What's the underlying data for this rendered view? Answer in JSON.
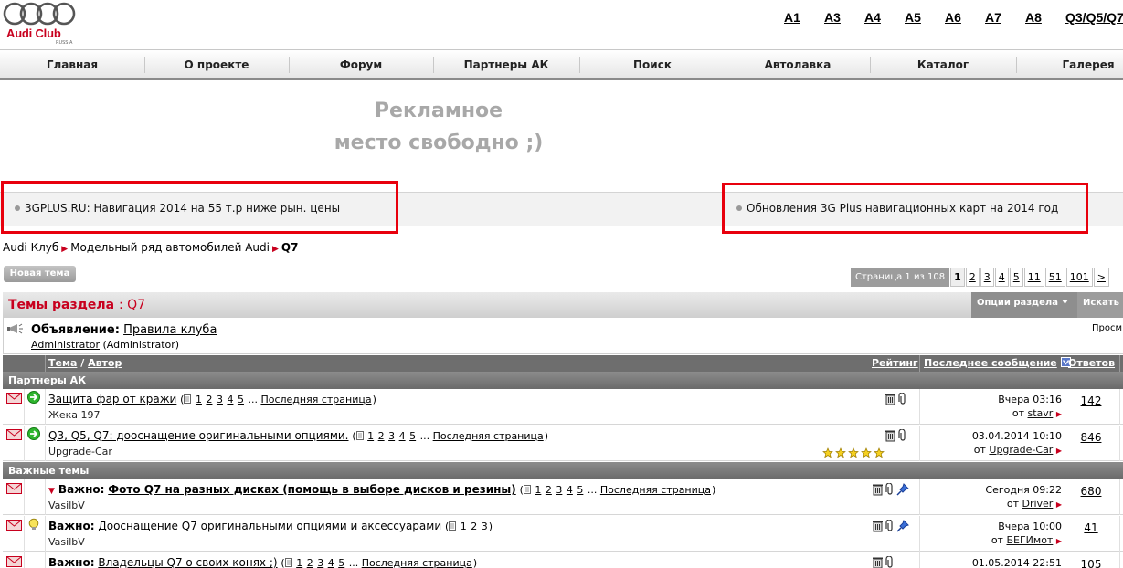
{
  "header": {
    "logo_text": "Audi Club",
    "logo_sub": "RUSSIA",
    "models": [
      "A1",
      "A3",
      "A4",
      "A5",
      "A6",
      "A7",
      "A8",
      "Q3/Q5/Q7"
    ]
  },
  "nav": [
    "Главная",
    "О проекте",
    "Форум",
    "Партнеры АК",
    "Поиск",
    "Автолавка",
    "Каталог",
    "Галерея"
  ],
  "ad": {
    "line1": "Рекламное",
    "line2": "место свободно ;)"
  },
  "promo": {
    "left": "3GPLUS.RU: Навигация 2014 на 55 т.р ниже рын. цены",
    "right": "Обновления 3G Plus навигационных карт на 2014 год"
  },
  "breadcrumb": {
    "item1": "Audi Клуб",
    "item2": "Модельный ряд автомобилей Audi",
    "current": "Q7"
  },
  "new_topic_button": "Новая тема",
  "pager": {
    "label": "Страница 1 из 108",
    "current": "1",
    "pages": [
      "2",
      "3",
      "4",
      "5",
      "11",
      "51",
      "101",
      ">"
    ]
  },
  "table_header": {
    "title": "Темы раздела",
    "forum": ": Q7",
    "options": "Опции раздела",
    "search": "Искать в"
  },
  "announcement": {
    "prefix": "Объявление:",
    "title": "Правила клуба",
    "author": "Administrator",
    "role": "(Administrator)",
    "views_label": "Просм"
  },
  "columns": {
    "topic": "Тема",
    "author": "Автор",
    "rating": "Рейтинг",
    "last_post": "Последнее сообщение",
    "replies": "Ответов"
  },
  "sections": {
    "partners": "Партнеры АК",
    "important": "Важные темы"
  },
  "threads": [
    {
      "title": "Защита фар от кражи",
      "pages": [
        "1",
        "2",
        "3",
        "4",
        "5"
      ],
      "last_page": "Последняя страница",
      "author": "Жека 197",
      "last_date": "Вчера 03:16",
      "last_user": "stavr",
      "replies": "142"
    },
    {
      "title": "Q3, Q5, Q7: дооснащение оригинальными опциями.",
      "pages": [
        "1",
        "2",
        "3",
        "4",
        "5"
      ],
      "last_page": "Последняя страница",
      "author": "Upgrade-Car",
      "last_date": "03.04.2014 10:10",
      "last_user": "Upgrade-Car",
      "replies": "846",
      "rating": 5
    },
    {
      "prefix": "Важно:",
      "title": "Фото Q7 на разных дисках (помощь в выборе дисков и резины)",
      "pages": [
        "1",
        "2",
        "3",
        "4",
        "5"
      ],
      "last_page": "Последняя страница",
      "author": "VasilbV",
      "last_date": "Сегодня 09:22",
      "last_user": "Driver",
      "replies": "680"
    },
    {
      "prefix": "Важно:",
      "title": "Дооснащение Q7 оригинальными опциями и аксессуарами",
      "pages": [
        "1",
        "2",
        "3"
      ],
      "author": "VasilbV",
      "last_date": "Вчера 10:00",
      "last_user": "БЕГИмот",
      "replies": "41"
    },
    {
      "prefix": "Важно:",
      "title": "Владельцы Q7 о своих конях ;)",
      "pages": [
        "1",
        "2",
        "3",
        "4",
        "5"
      ],
      "last_page": "Последняя страница",
      "last_date": "01.05.2014 22:51",
      "replies": "105"
    }
  ],
  "from_label": "от",
  "ellipsis": "...",
  "colors": {
    "accent": "#c8001e",
    "highlight_box": "#e8000d"
  }
}
